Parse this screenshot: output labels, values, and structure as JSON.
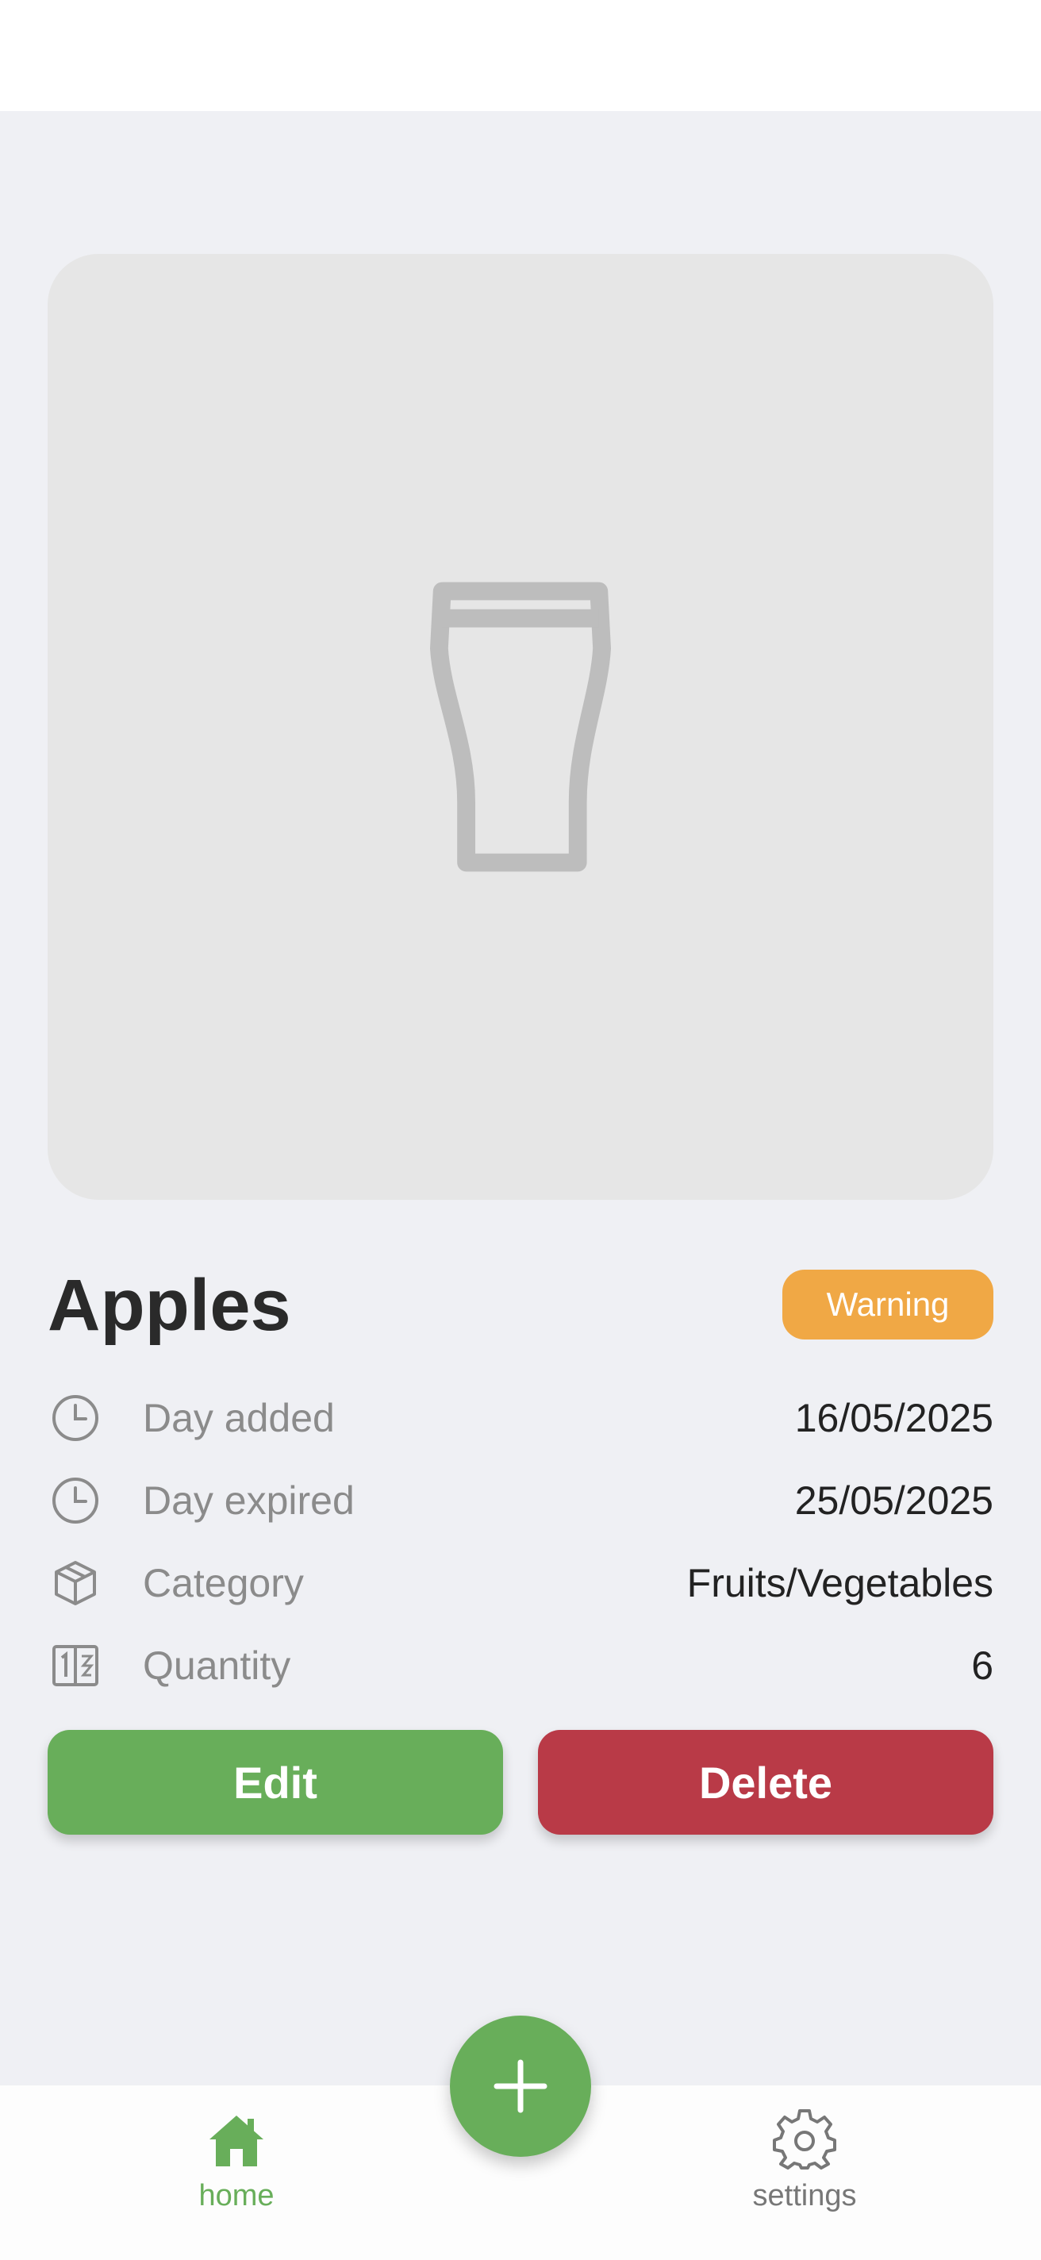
{
  "item": {
    "name": "Apples",
    "status_badge": "Warning",
    "image_icon": "pint-glass-icon"
  },
  "details": [
    {
      "icon": "clock-icon",
      "label": "Day added",
      "value": "16/05/2025"
    },
    {
      "icon": "clock-icon",
      "label": "Day expired",
      "value": "25/05/2025"
    },
    {
      "icon": "box-icon",
      "label": "Category",
      "value": "Fruits/Vegetables"
    },
    {
      "icon": "counter-icon",
      "label": "Quantity",
      "value": "6"
    }
  ],
  "actions": {
    "edit_label": "Edit",
    "delete_label": "Delete"
  },
  "nav": {
    "home_label": "home",
    "settings_label": "settings",
    "active": "home"
  },
  "fab": {
    "icon": "plus-icon"
  },
  "colors": {
    "primary": "#68ae5a",
    "danger": "#b93a47",
    "warning": "#f0a845",
    "background": "#eff0f4",
    "image_placeholder": "#e6e6e6"
  }
}
